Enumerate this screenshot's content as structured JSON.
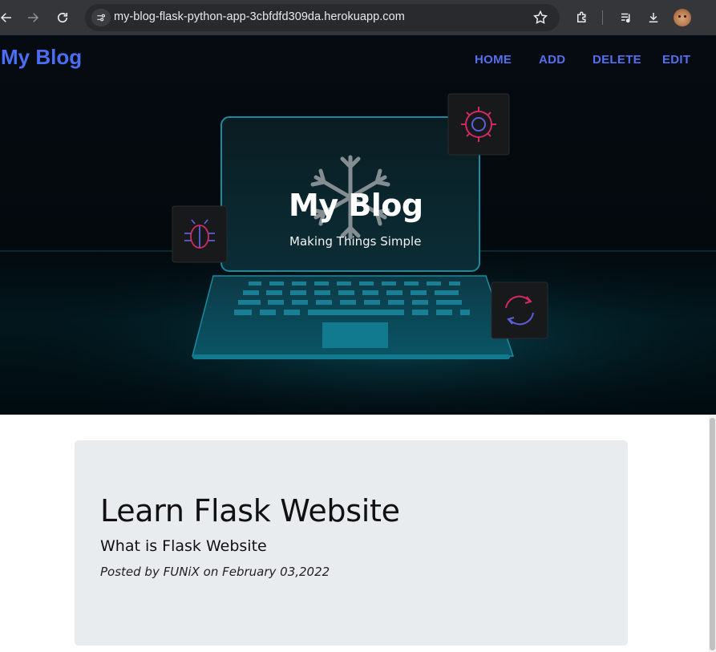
{
  "browser": {
    "url": "my-blog-flask-python-app-3cbfdfd309da.herokuapp.com",
    "icons": [
      "back-icon",
      "forward-icon",
      "reload-icon",
      "site-info-icon",
      "bookmark-star-icon",
      "extensions-icon",
      "media-controls-icon",
      "download-icon",
      "profile-avatar"
    ]
  },
  "navbar": {
    "brand": "My Blog",
    "links": [
      "HOME",
      "ADD",
      "DELETE",
      "EDIT"
    ],
    "link_color": "#5470f0"
  },
  "hero": {
    "title": "My Blog",
    "subtitle": "Making Things Simple"
  },
  "post": {
    "title": "Learn Flask Website",
    "subtitle": "What is Flask Website",
    "meta": "Posted by FUNiX on February 03,2022"
  }
}
